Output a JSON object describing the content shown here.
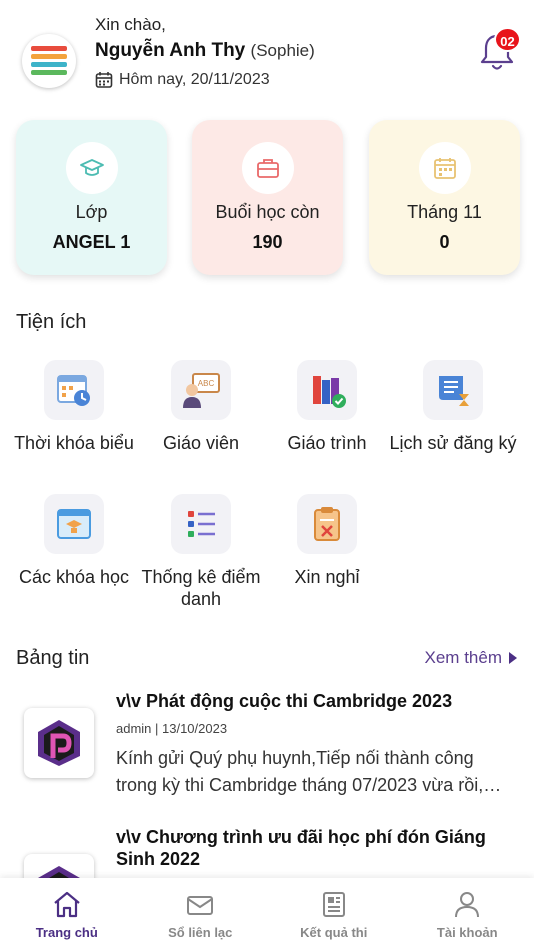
{
  "header": {
    "greeting": "Xin chào,",
    "name": "Nguyễn Anh Thy",
    "nickname": "(Sophie)",
    "date": "Hôm nay, 20/11/2023",
    "notification_count": "02"
  },
  "stats": [
    {
      "label": "Lớp",
      "value": "ANGEL 1",
      "icon": "graduation-cap-icon",
      "bg": "#e6f8f6",
      "color": "#4cbcb2"
    },
    {
      "label": "Buổi học còn",
      "value": "190",
      "icon": "briefcase-icon",
      "bg": "#fde9e6",
      "color": "#e9696a"
    },
    {
      "label": "Tháng 11",
      "value": "0",
      "icon": "calendar-icon",
      "bg": "#fdf7e3",
      "color": "#e8c272"
    }
  ],
  "utilities": {
    "title": "Tiện ích",
    "items": [
      {
        "label": "Thời khóa biểu",
        "icon": "timetable-icon"
      },
      {
        "label": "Giáo viên",
        "icon": "teacher-icon"
      },
      {
        "label": "Giáo trình",
        "icon": "textbook-icon"
      },
      {
        "label": "Lịch sử đăng ký",
        "icon": "registration-history-icon"
      },
      {
        "label": "Các khóa học",
        "icon": "courses-icon"
      },
      {
        "label": "Thống kê điểm danh",
        "icon": "attendance-icon"
      },
      {
        "label": "Xin nghỉ",
        "icon": "leave-request-icon"
      }
    ]
  },
  "news": {
    "title": "Bảng tin",
    "see_more": "Xem thêm",
    "items": [
      {
        "title": "v\\v Phát động cuộc thi Cambridge 2023",
        "meta": "admin | 13/10/2023",
        "excerpt": "Kính gửi Quý phụ huynh,Tiếp nối thành công trong kỳ thi Cambridge tháng 07/2023 vừa rồi,…"
      },
      {
        "title": "v\\v Chương trình ưu đãi học phí đón Giáng Sinh 2022"
      }
    ]
  },
  "bottom_nav": [
    {
      "label": "Trang chủ",
      "icon": "home-icon",
      "active": true
    },
    {
      "label": "Sổ liên lạc",
      "icon": "envelope-icon",
      "active": false
    },
    {
      "label": "Kết quả thi",
      "icon": "newspaper-icon",
      "active": false
    },
    {
      "label": "Tài khoản",
      "icon": "user-icon",
      "active": false
    }
  ],
  "colors": {
    "accent": "#4b2f84",
    "badge": "#e8141b"
  }
}
